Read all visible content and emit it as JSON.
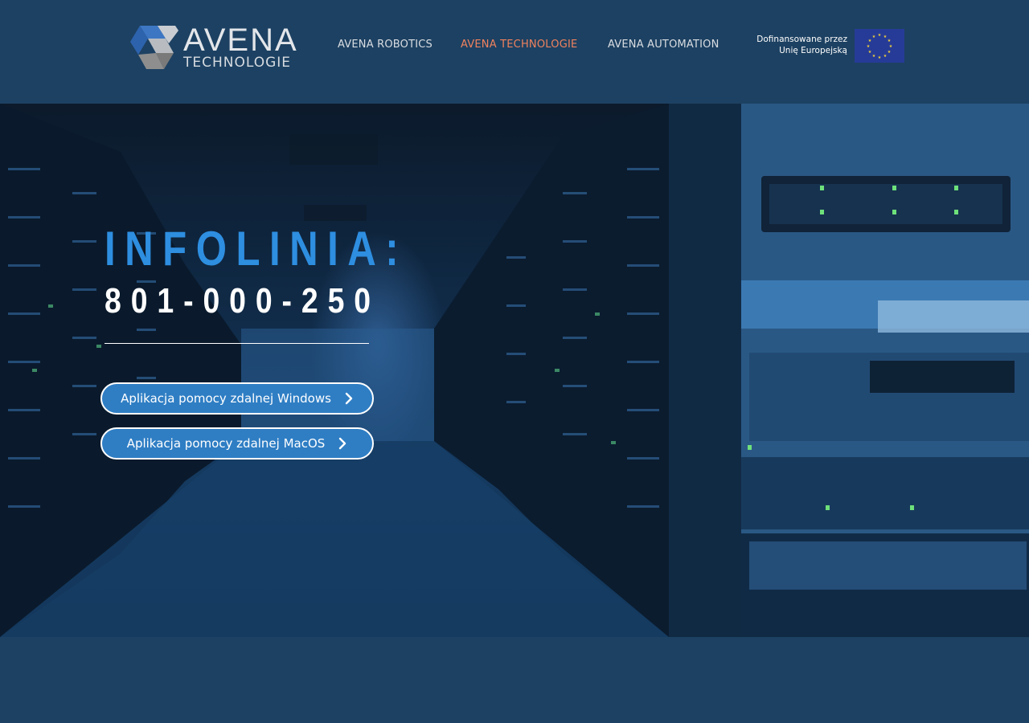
{
  "header": {
    "logo": {
      "word": "AVENA",
      "sub": "TECHNOLOGIE"
    },
    "nav": [
      {
        "label": "AVENA ROBOTICS",
        "active": false
      },
      {
        "label": "AVENA TECHNOLOGIE",
        "active": true
      },
      {
        "label": "AVENA AUTOMATION",
        "active": false
      }
    ],
    "eu": {
      "line1": "Dofinansowane przez",
      "line2": "Unię Europejską"
    }
  },
  "hero": {
    "title": "INFOLINIA:",
    "phone": "801-000-250",
    "buttons": [
      {
        "label": "Aplikacja pomocy zdalnej Windows",
        "icon": "chevron-right-icon"
      },
      {
        "label": "Aplikacja pomocy zdalnej MacOS",
        "icon": "chevron-right-icon"
      }
    ]
  },
  "colors": {
    "background": "#1d4162",
    "accent": "#2e8ee0",
    "active_nav": "#f0825e",
    "button": "#2f7ec4"
  }
}
